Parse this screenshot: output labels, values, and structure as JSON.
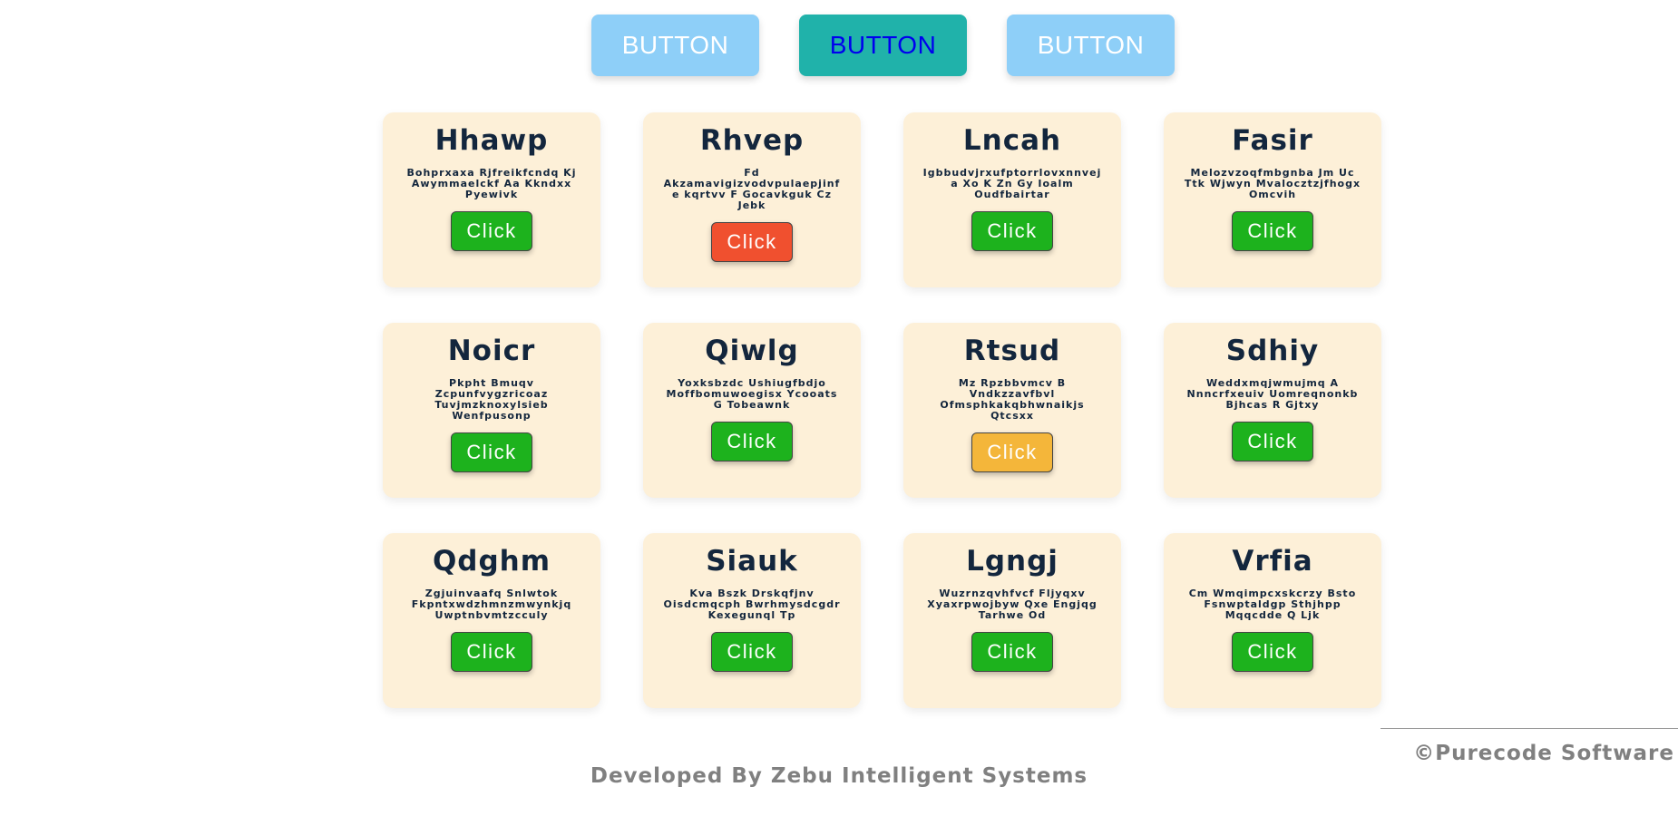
{
  "colors": {
    "card_bg": "#fdf0d8",
    "top_button_light": "#8ecff8",
    "top_button_active": "#20b2aa",
    "green": "#1db21d",
    "red": "#f0502f",
    "yellow": "#f4b63a"
  },
  "top_buttons": [
    {
      "label": "BUTTON",
      "state": "light"
    },
    {
      "label": "BUTTON",
      "state": "active"
    },
    {
      "label": "BUTTON",
      "state": "light"
    }
  ],
  "cards": [
    {
      "title": "Hhawp",
      "desc": "Bohprxaxa Rjfreikfcndq Kj Awymmaelckf Aa Kkndxx Pyewivk",
      "button": "Click",
      "button_color": "#1db21d"
    },
    {
      "title": "Rhvep",
      "desc": "Fd Akzamavigizvodvpulaepjinfe kqrtvv F Gocavkguk Cz Jebk",
      "button": "Click",
      "button_color": "#f0502f"
    },
    {
      "title": "Lncah",
      "desc": "Igbbudvjrxufptorrlovxnnvej a Xo K Zn Gy Ioalm Oudfbairtar",
      "button": "Click",
      "button_color": "#1db21d"
    },
    {
      "title": "Fasir",
      "desc": "Melozvzoqfmbgnba Jm Uc Ttk Wjwyn Mvalocztzjfhogx Omcvih",
      "button": "Click",
      "button_color": "#1db21d"
    },
    {
      "title": "Noicr",
      "desc": "Pkpht Bmuqv Zcpunfvygzricoaz Tuvjmzknoxylsieb Wenfpusonp",
      "button": "Click",
      "button_color": "#1db21d"
    },
    {
      "title": "Qiwlg",
      "desc": "Yoxksbzdc Ushiugfbdjo Moffbomuwoegisx Ycooats G Tobeawnk",
      "button": "Click",
      "button_color": "#1db21d"
    },
    {
      "title": "Rtsud",
      "desc": "Mz Rpzbbvmcv B Vndkzzavfbvl Ofmsphkakqbhwnaikjs Qtcsxx",
      "button": "Click",
      "button_color": "#f4b63a"
    },
    {
      "title": "Sdhiy",
      "desc": "Weddxmqjwmujmq A Nnncrfxeuiv Uomreqnonkb Bjhcas R Gjtxy",
      "button": "Click",
      "button_color": "#1db21d"
    },
    {
      "title": "Qdghm",
      "desc": "Zgjuinvaafq Snlwtok Fkpntxwdzhmnzmwynkjq Uwptnbvmtzcculy",
      "button": "Click",
      "button_color": "#1db21d"
    },
    {
      "title": "Siauk",
      "desc": "Kva Bszk Drskqfjnv Oisdcmqcph Bwrhmysdcgdr Kexegunql Tp",
      "button": "Click",
      "button_color": "#1db21d"
    },
    {
      "title": "Lgngj",
      "desc": "Wuzrnzqvhfvcf Fljyqxv Xyaxrpwojbyw Qxe Engjqg Tarhwe Od",
      "button": "Click",
      "button_color": "#1db21d"
    },
    {
      "title": "Vrfia",
      "desc": "Cm Wmqimpcxskcrzy Bsto Fsnwptaldgp Sthjhpp Mqqcdde Q Ljk",
      "button": "Click",
      "button_color": "#1db21d"
    }
  ],
  "footer": {
    "copyright": "©Purecode Software",
    "credit": "Developed By Zebu Intelligent Systems"
  }
}
